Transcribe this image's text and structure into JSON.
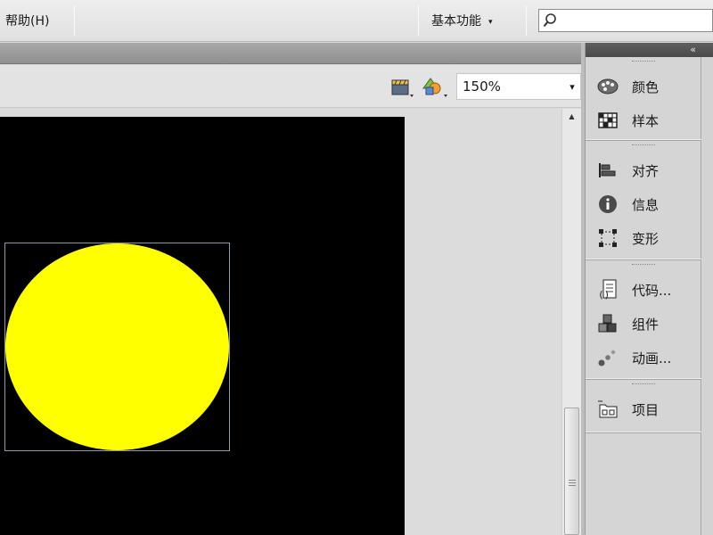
{
  "menubar": {
    "help_label": "帮助(H)",
    "workspace_label": "基本功能",
    "workspace_caret": "▾",
    "search_value": ""
  },
  "toolbar": {
    "edit_scene_icon": "clapperboard-icon",
    "edit_symbol_icon": "shapes-icon",
    "zoom_value": "150%",
    "zoom_caret": "▾"
  },
  "stage": {
    "background": "#000000",
    "shape_color": "#ffff00",
    "shape_icon": "circle-shape"
  },
  "scrollbar": {
    "up_arrow": "▲"
  },
  "panel_dock": {
    "collapse_label": "«",
    "groups": [
      {
        "items": [
          {
            "label": "颜色",
            "icon": "palette-icon"
          },
          {
            "label": "样本",
            "icon": "swatch-grid-icon"
          }
        ]
      },
      {
        "items": [
          {
            "label": "对齐",
            "icon": "align-icon"
          },
          {
            "label": "信息",
            "icon": "info-icon"
          },
          {
            "label": "变形",
            "icon": "transform-icon"
          }
        ]
      },
      {
        "items": [
          {
            "label": "代码...",
            "icon": "code-snippet-icon"
          },
          {
            "label": "组件",
            "icon": "components-icon"
          },
          {
            "label": "动画...",
            "icon": "motion-presets-icon"
          }
        ]
      },
      {
        "items": [
          {
            "label": "项目",
            "icon": "project-folder-icon"
          }
        ]
      }
    ]
  }
}
